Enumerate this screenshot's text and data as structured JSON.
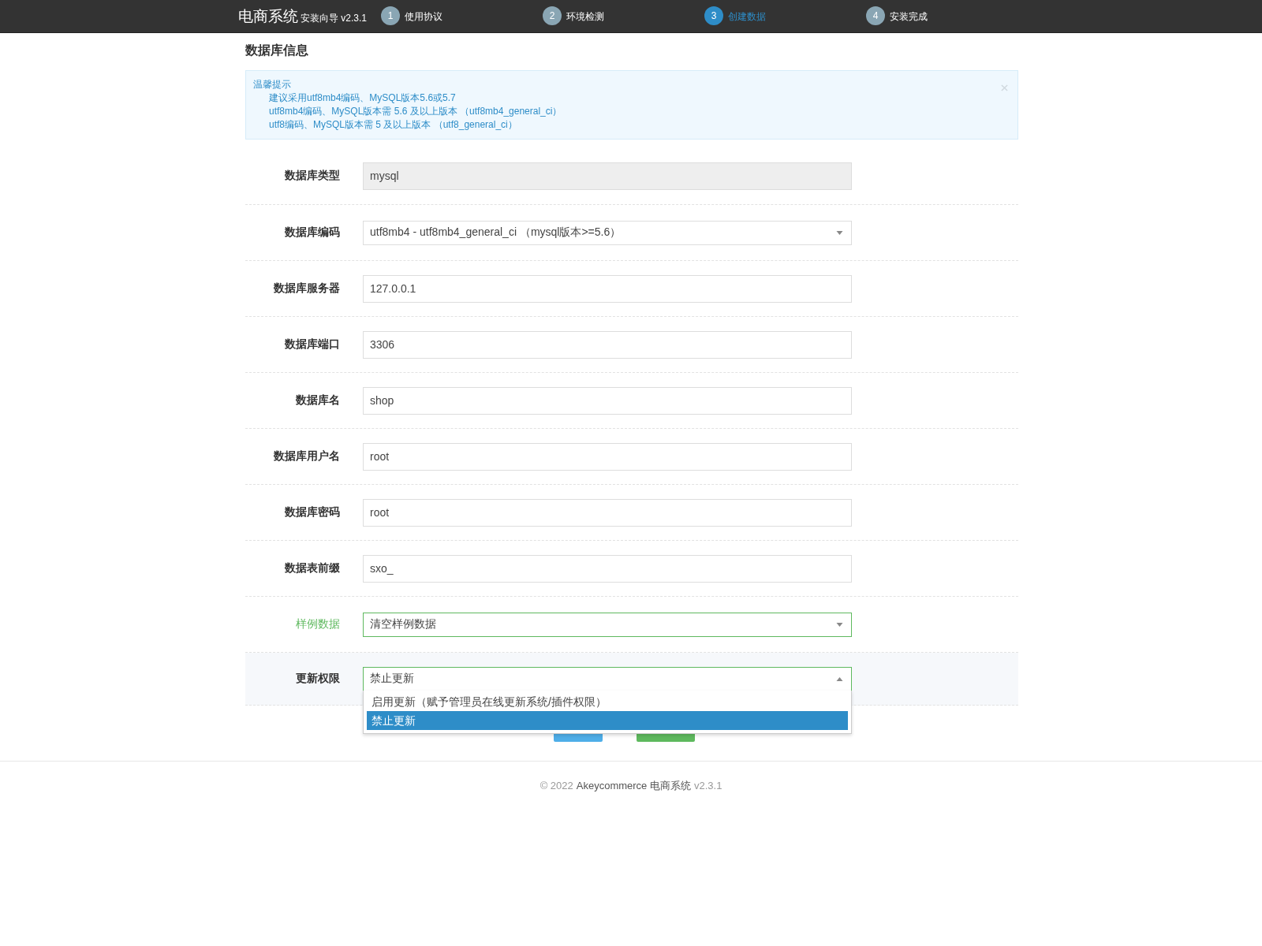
{
  "header": {
    "brand": "电商系统",
    "subtitle": "安装向导 v2.3.1",
    "steps": [
      {
        "number": "1",
        "label": "使用协议",
        "selected": false
      },
      {
        "number": "2",
        "label": "环境检测",
        "selected": false
      },
      {
        "number": "3",
        "label": "创建数据",
        "selected": true
      },
      {
        "number": "4",
        "label": "安装完成",
        "selected": false
      }
    ]
  },
  "section_title": "数据库信息",
  "alert": {
    "title": "温馨提示",
    "lines": [
      "建议采用utf8mb4编码、MySQL版本5.6或5.7",
      "utf8mb4编码、MySQL版本需 5.6 及以上版本 （utf8mb4_general_ci）",
      "utf8编码、MySQL版本需 5 及以上版本 （utf8_general_ci）"
    ]
  },
  "fields": [
    {
      "label": "数据库类型",
      "kind": "readonly",
      "value": "mysql",
      "valid": false
    },
    {
      "label": "数据库编码",
      "kind": "select",
      "value": "utf8mb4 - utf8mb4_general_ci （mysql版本>=5.6）",
      "valid": false
    },
    {
      "label": "数据库服务器",
      "kind": "text",
      "value": "127.0.0.1",
      "valid": false
    },
    {
      "label": "数据库端口",
      "kind": "text",
      "value": "3306",
      "valid": false
    },
    {
      "label": "数据库名",
      "kind": "text",
      "value": "shop",
      "valid": false
    },
    {
      "label": "数据库用户名",
      "kind": "text",
      "value": "root",
      "valid": false
    },
    {
      "label": "数据库密码",
      "kind": "text",
      "value": "root",
      "valid": false
    },
    {
      "label": "数据表前缀",
      "kind": "text",
      "value": "sxo_",
      "valid": false
    },
    {
      "label": "样例数据",
      "kind": "select",
      "value": "清空样例数据",
      "valid": true
    },
    {
      "label": "更新权限",
      "kind": "select",
      "value": "禁止更新",
      "valid": true,
      "expanded": true,
      "options": [
        {
          "label": "启用更新（赋予管理员在线更新系统/插件权限）",
          "selected": false
        },
        {
          "label": "禁止更新",
          "selected": true
        }
      ]
    }
  ],
  "buttons": [
    {
      "kind": "back"
    },
    {
      "kind": "confirm"
    }
  ],
  "footer": {
    "copyright": "© 2022",
    "product": "Akeycommerce 电商系统",
    "version": "v2.3.1"
  }
}
